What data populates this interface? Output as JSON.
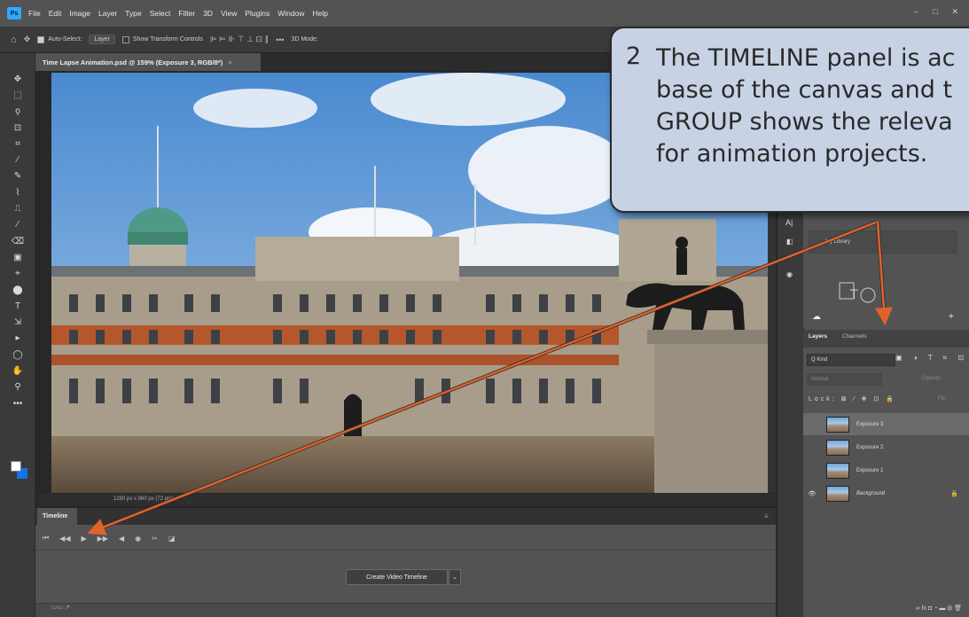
{
  "app": {
    "logo": "Ps",
    "menu": [
      "File",
      "Edit",
      "Image",
      "Layer",
      "Type",
      "Select",
      "Filter",
      "3D",
      "View",
      "Plugins",
      "Window",
      "Help"
    ],
    "window_controls": [
      "–",
      "□",
      "✕"
    ]
  },
  "options_bar": {
    "home_glyph": "⌂",
    "move_glyph": "✥",
    "auto_select_label": "Auto-Select:",
    "auto_select_value": "Layer",
    "show_transform_label": "Show Transform Controls",
    "align_glyphs": "⊫ ⊨ ⊪   ⊤ ⊥ ⊡   ∥",
    "more_glyph": "•••",
    "mode_label": "3D Mode:"
  },
  "toolbar": {
    "tools": [
      "✥",
      "⬚",
      "ϙ",
      "⊡",
      "⌗",
      "⁄",
      "✎",
      "⌇",
      "⎍",
      "⁄",
      "⌫",
      "▣",
      "⌖",
      "⬤",
      "T",
      "⇲",
      "▸",
      "◯",
      "✋",
      "⚲",
      "•••"
    ]
  },
  "document": {
    "tab_title": "Time Lapse Animation.psd @ 159% (Exposure 3, RGB/8*)",
    "tab_close": "×",
    "status_text": "1280 px x 960 px (72 ppi)"
  },
  "timeline": {
    "tab_label": "Timeline",
    "controls": [
      "⏮",
      "◀◀",
      "▶",
      "▶▶",
      "◀",
      "◉",
      "✂",
      "◪"
    ],
    "create_button": "Create Video Timeline",
    "create_dropdown": "⌄",
    "footer_icons": "▭▭  ↗"
  },
  "right_panels": {
    "strip_icons": [
      "A|",
      "◧",
      "◉"
    ],
    "library_item": "My Library",
    "layers_tab": "Layers",
    "channels_tab": "Channels",
    "kind_filter": "Q Kind",
    "kind_icons": "▣ ◑ T ⌗ ⊡",
    "blend_mode": "Normal",
    "opacity_label": "Opacity:",
    "lock_label": "Lock: ⊠ ⁄ ✥ ⊡ 🔒",
    "fill_label": "Fill:",
    "layers": [
      {
        "name": "Exposure 3",
        "visible": false,
        "selected": true,
        "italic": false,
        "locked": false
      },
      {
        "name": "Exposure 2",
        "visible": false,
        "selected": false,
        "italic": false,
        "locked": false
      },
      {
        "name": "Exposure 1",
        "visible": false,
        "selected": false,
        "italic": false,
        "locked": false
      },
      {
        "name": "Background",
        "visible": true,
        "selected": false,
        "italic": true,
        "locked": true
      }
    ],
    "footer_icons": "∞  fx  ◘  ◔  ▬  ⊞  🗑",
    "eye_glyph": "👁",
    "lock_glyph": "🔒"
  },
  "callout": {
    "number": "2",
    "text": "The TIMELINE panel is ac base of the canvas and t GROUP shows the releva for animation projects.",
    "lines": [
      "The TIMELINE panel is ac",
      "base of the canvas and t",
      "GROUP shows the releva",
      "for animation projects."
    ]
  },
  "colors": {
    "accent": "#31a8ff",
    "callout_fill": "#c7d3e5",
    "arrow": "#e0622a"
  }
}
